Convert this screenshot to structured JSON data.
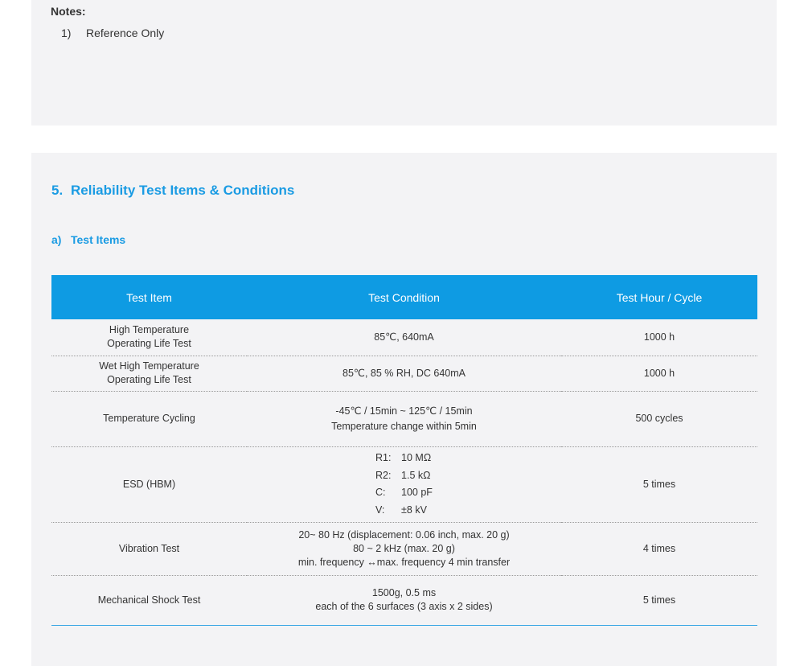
{
  "notes": {
    "title": "Notes:",
    "items": [
      {
        "num": "1)",
        "text": "Reference Only"
      }
    ]
  },
  "section": {
    "num": "5.",
    "title": "Reliability Test Items & Conditions",
    "sub_num": "a)",
    "sub_title": "Test Items"
  },
  "table": {
    "headers": [
      "Test Item",
      "Test Condition",
      "Test Hour / Cycle"
    ],
    "rows": [
      {
        "item": [
          "High Temperature",
          "Operating Life Test"
        ],
        "condition": [
          "85℃, 640mA"
        ],
        "hours": "1000 h"
      },
      {
        "item": [
          "Wet High Temperature",
          "Operating Life Test"
        ],
        "condition": [
          "85℃, 85 % RH, DC 640mA"
        ],
        "hours": "1000 h"
      },
      {
        "item": [
          "Temperature Cycling"
        ],
        "condition": [
          "-45℃  / 15min ~ 125℃  / 15min",
          "Temperature change within 5min"
        ],
        "hours": "500 cycles"
      },
      {
        "item": [
          "ESD (HBM)"
        ],
        "esd": [
          {
            "k": "R1:",
            "v": "10 MΩ"
          },
          {
            "k": "R2:",
            "v": "1.5 kΩ"
          },
          {
            "k": "C:",
            "v": "100 pF"
          },
          {
            "k": "V:",
            "v": "±8 kV"
          }
        ],
        "hours": "5 times"
      },
      {
        "item": [
          "Vibration Test"
        ],
        "condition": [
          "20~ 80 Hz (displacement: 0.06 inch, max. 20 g)",
          "80 ~ 2 kHz (max. 20 g)",
          "min. frequency ↔max. frequency 4 min transfer"
        ],
        "hours": "4 times"
      },
      {
        "item": [
          "Mechanical Shock Test"
        ],
        "condition": [
          "1500g, 0.5 ms",
          "each of the 6 surfaces (3 axis x 2 sides)"
        ],
        "hours": "5 times"
      }
    ]
  }
}
